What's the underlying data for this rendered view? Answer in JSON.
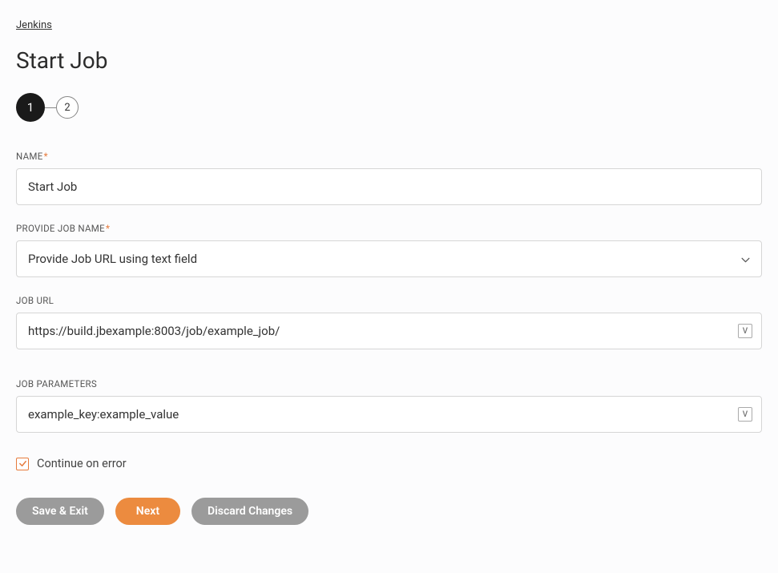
{
  "breadcrumb": "Jenkins",
  "pageTitle": "Start Job",
  "stepper": {
    "step1": "1",
    "step2": "2"
  },
  "fields": {
    "name": {
      "label": "NAME",
      "value": "Start Job"
    },
    "provideJobName": {
      "label": "PROVIDE JOB NAME",
      "value": "Provide Job URL using text field"
    },
    "jobUrl": {
      "label": "JOB URL",
      "value": "https://build.jbexample:8003/job/example_job/"
    },
    "jobParameters": {
      "label": "JOB PARAMETERS",
      "value": "example_key:example_value"
    }
  },
  "continueOnError": {
    "label": "Continue on error",
    "checked": true
  },
  "buttons": {
    "saveExit": "Save & Exit",
    "next": "Next",
    "discard": "Discard Changes"
  }
}
